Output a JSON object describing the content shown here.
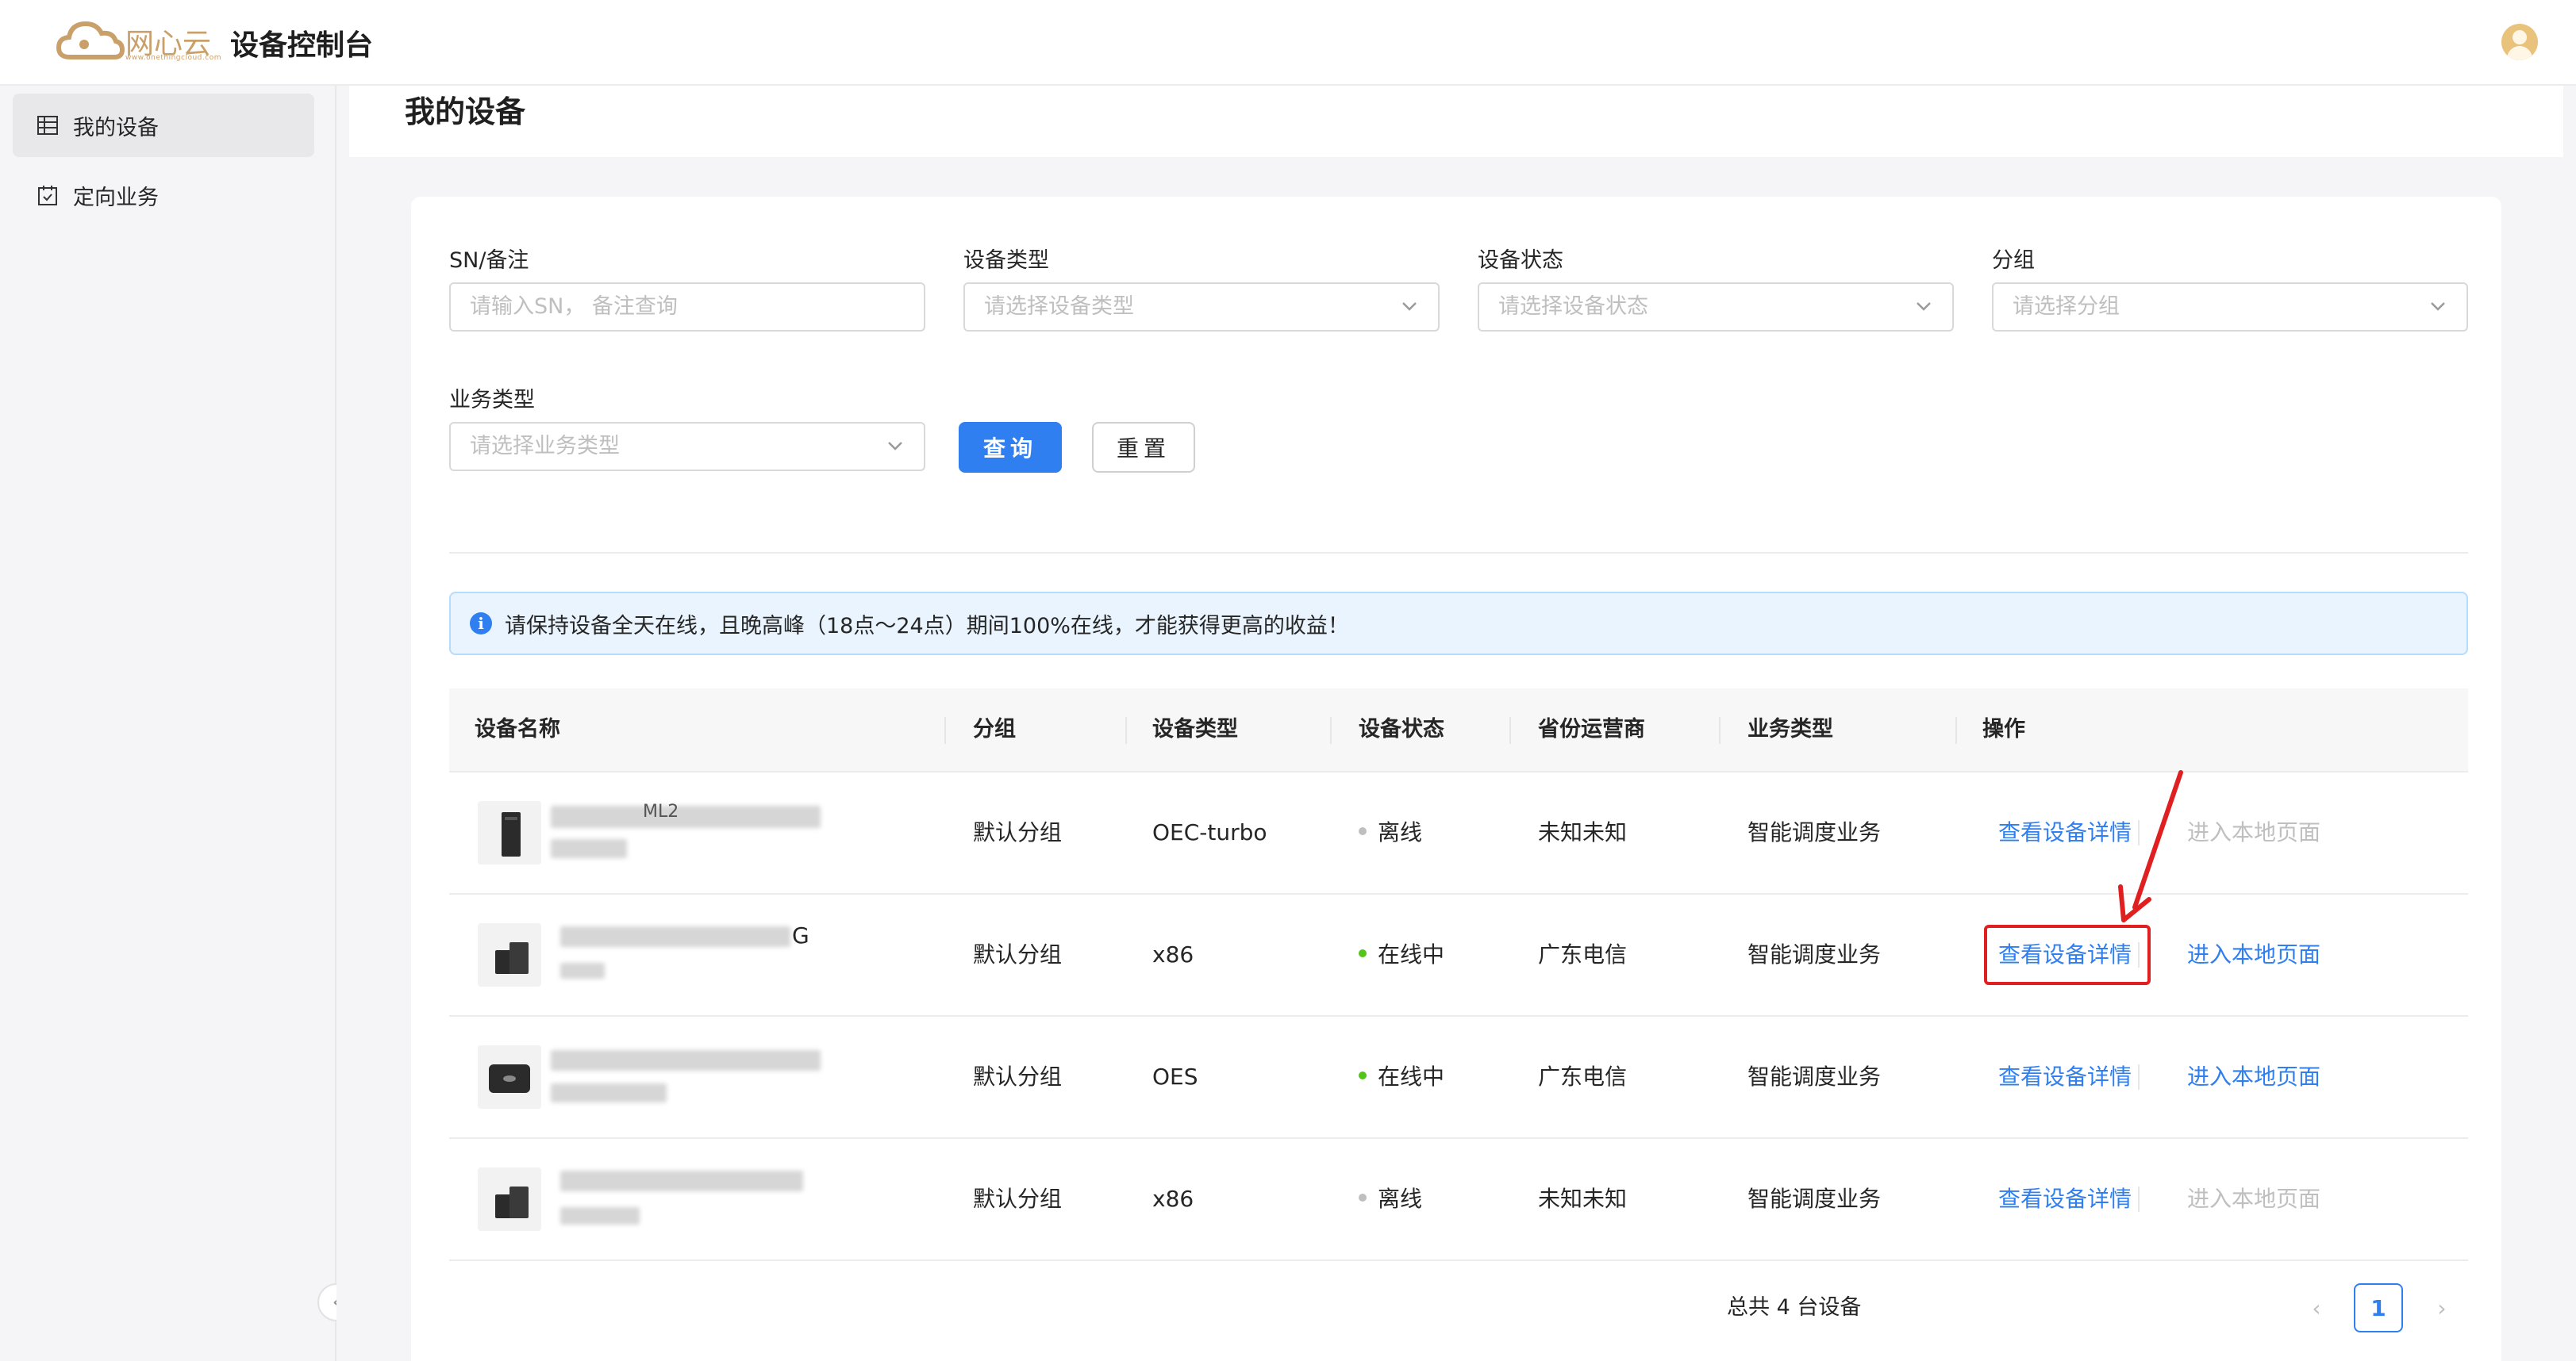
{
  "header": {
    "logo_text": "网心云",
    "logo_sub": "www.onethingcloud.com",
    "console_title": "设备控制台"
  },
  "sidebar": {
    "items": [
      {
        "label": "我的设备",
        "icon": "table-icon",
        "active": true
      },
      {
        "label": "定向业务",
        "icon": "calendar-check-icon",
        "active": false
      }
    ],
    "collapse_glyph": "‹"
  },
  "page": {
    "title": "我的设备"
  },
  "filters": {
    "sn": {
      "label": "SN/备注",
      "placeholder": "请输入SN， 备注查询"
    },
    "device_type": {
      "label": "设备类型",
      "placeholder": "请选择设备类型"
    },
    "device_status": {
      "label": "设备状态",
      "placeholder": "请选择设备状态"
    },
    "group": {
      "label": "分组",
      "placeholder": "请选择分组"
    },
    "business_type": {
      "label": "业务类型",
      "placeholder": "请选择业务类型"
    },
    "query_label": "查询",
    "reset_label": "重置"
  },
  "alert": {
    "icon": "i",
    "text": "请保持设备全天在线，且晚高峰（18点～24点）期间100%在线，才能获得更高的收益！"
  },
  "table": {
    "columns": [
      "设备名称",
      "分组",
      "设备类型",
      "设备状态",
      "省份运营商",
      "业务类型",
      "操作"
    ],
    "rows": [
      {
        "name_fragment": "ML2",
        "group": "默认分组",
        "type": "OEC-turbo",
        "status": "离线",
        "status_color": "#bfbfbf",
        "carrier": "未知未知",
        "business": "智能调度业务",
        "detail": "查看设备详情",
        "local": "进入本地页面",
        "local_enabled": false
      },
      {
        "name_fragment": "G",
        "group": "默认分组",
        "type": "x86",
        "status": "在线中",
        "status_color": "#52c41a",
        "carrier": "广东电信",
        "business": "智能调度业务",
        "detail": "查看设备详情",
        "local": "进入本地页面",
        "local_enabled": true
      },
      {
        "name_fragment": "",
        "group": "默认分组",
        "type": "OES",
        "status": "在线中",
        "status_color": "#52c41a",
        "carrier": "广东电信",
        "business": "智能调度业务",
        "detail": "查看设备详情",
        "local": "进入本地页面",
        "local_enabled": true
      },
      {
        "name_fragment": "",
        "group": "默认分组",
        "type": "x86",
        "status": "离线",
        "status_color": "#bfbfbf",
        "carrier": "未知未知",
        "business": "智能调度业务",
        "detail": "查看设备详情",
        "local": "进入本地页面",
        "local_enabled": false
      }
    ]
  },
  "pagination": {
    "total_text": "总共 4 台设备",
    "prev": "‹",
    "current_page": "1",
    "next": "›"
  },
  "colors": {
    "primary": "#2f7ff0",
    "brand": "#c9a06a",
    "online": "#52c41a",
    "offline": "#bfbfbf",
    "annotation": "#e02020"
  }
}
